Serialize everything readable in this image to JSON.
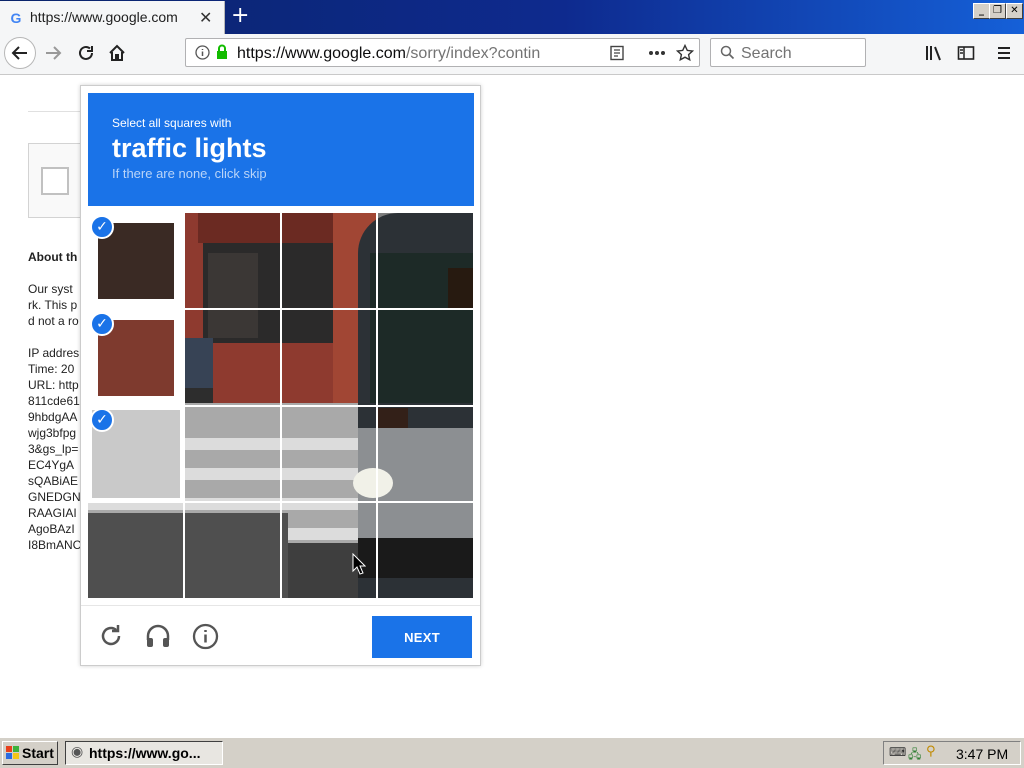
{
  "browser": {
    "tab_title": "https://www.google.com",
    "tab_favicon": "G",
    "url_host": "https://www.google.com",
    "url_path": "/sorry/index?contin",
    "search_placeholder": "Search"
  },
  "page": {
    "about_heading": "About th",
    "para_lines": [
      "Our syst",
      "rk. This p",
      "d not a ro"
    ],
    "info_lines": [
      "IP addres",
      "Time: 20",
      "URL: http",
      "811cde61",
      "9hbdgAA",
      "wjg3bfpg",
      "3&gs_lp=",
      "EC4YgA",
      "sQABiAE",
      "GNEDGN",
      "RAAGIAI",
      "AgoBAzI",
      "I8BmANC"
    ]
  },
  "captcha": {
    "instruction": "Select all squares with",
    "target": "traffic lights",
    "hint": "If there are none, click skip",
    "next_label": "NEXT",
    "selected_tiles": [
      0,
      4,
      8
    ]
  },
  "taskbar": {
    "start_label": "Start",
    "task_label": "https://www.go...",
    "clock": "3:47 PM"
  },
  "colors": {
    "accent": "#1a73e8",
    "titlebar": "#0a246a"
  },
  "icons": [
    "google-favicon",
    "back-arrow-icon",
    "forward-arrow-icon",
    "reload-icon",
    "home-icon",
    "info-icon",
    "lock-icon",
    "reader-view-icon",
    "page-actions-icon",
    "star-icon",
    "search-icon",
    "library-icon",
    "sidebar-icon",
    "menu-icon",
    "check-icon",
    "refresh-icon",
    "headphones-icon",
    "info-circle-icon",
    "mouse-cursor-icon",
    "windows-logo-icon"
  ]
}
